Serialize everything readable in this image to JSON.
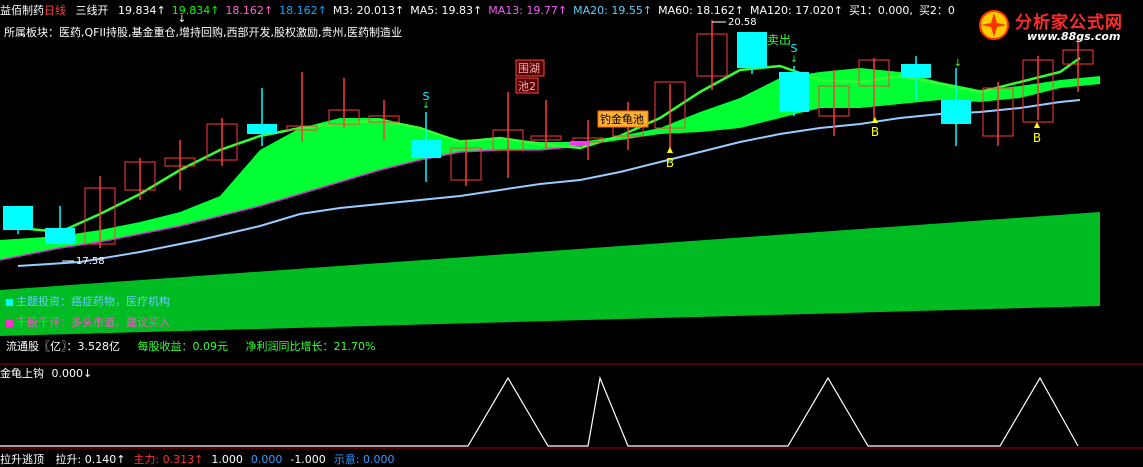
{
  "header": {
    "stock_name": "益佰制药",
    "period": "日线",
    "indicator_name": "三线开",
    "values": [
      {
        "text": "19.834↑",
        "color": "#ffffff"
      },
      {
        "text": "19.834↑",
        "color": "#00ff00"
      },
      {
        "text": "18.162↑",
        "color": "#ff66cc"
      },
      {
        "text": "18.162↑",
        "color": "#00aaff"
      },
      {
        "text": "M3: 20.013↑",
        "color": "#ffffff"
      },
      {
        "text": "MA5: 19.83↑",
        "color": "#ffffff"
      },
      {
        "text": "MA13: 19.77↑",
        "color": "#ff55ff"
      },
      {
        "text": "MA20: 19.55↑",
        "color": "#66ccff"
      },
      {
        "text": "MA60: 18.162↑",
        "color": "#ffffff"
      },
      {
        "text": "MA120: 17.020↑",
        "color": "#ffffff"
      },
      {
        "text": "买1：0.000,",
        "color": "#ffffff"
      },
      {
        "text": "买2：0",
        "color": "#ffffff"
      }
    ]
  },
  "sector": "所属板块：医药,QFII持股,基金重仓,增持回购,西部开发,股权激励,贵州,医药制造业",
  "logo": {
    "title": "分析家公式网",
    "url": "www.88gs.com"
  },
  "annotations": {
    "sell_out": "卖出",
    "high_price": "20.58",
    "low_price": "17.58",
    "sell_signal": "S",
    "buy_signal": "B",
    "box_wei": "围湖",
    "box_pool": "池2",
    "box_turtle": "钓金龟池"
  },
  "info": {
    "theme": "主题投资：癌症药物，医疗机构",
    "review": "千股千评：多头市道，建议买入"
  },
  "finance": {
    "float_shares": "流通股〖亿〗：3.528亿",
    "eps": "每股收益：0.09元",
    "profit_growth": "净利润同比增长：21.70%"
  },
  "indicator": {
    "name": "金龟上钩",
    "value": "0.000↓"
  },
  "bottom": {
    "name": "拉升逃顶",
    "items": [
      {
        "text": "拉升: 0.140↑",
        "color": "#ffffff"
      },
      {
        "text": "主力: 0.313↑",
        "color": "#ff3333"
      },
      {
        "text": "1.000",
        "color": "#ffffff"
      },
      {
        "text": "0.000",
        "color": "#3399ff"
      },
      {
        "text": "-1.000",
        "color": "#ffffff"
      },
      {
        "text": "示意: 0.000",
        "color": "#3399ff"
      }
    ]
  },
  "colors": {
    "up": "#ff3b3b",
    "down": "#00ffff",
    "band": "#00ff33",
    "volume": "#00cc22",
    "ma_light": "#99ccff",
    "ma_green": "#33ff33",
    "purple": "#cc33cc",
    "yellow": "#ffff00",
    "separator": "#aa0000"
  }
}
